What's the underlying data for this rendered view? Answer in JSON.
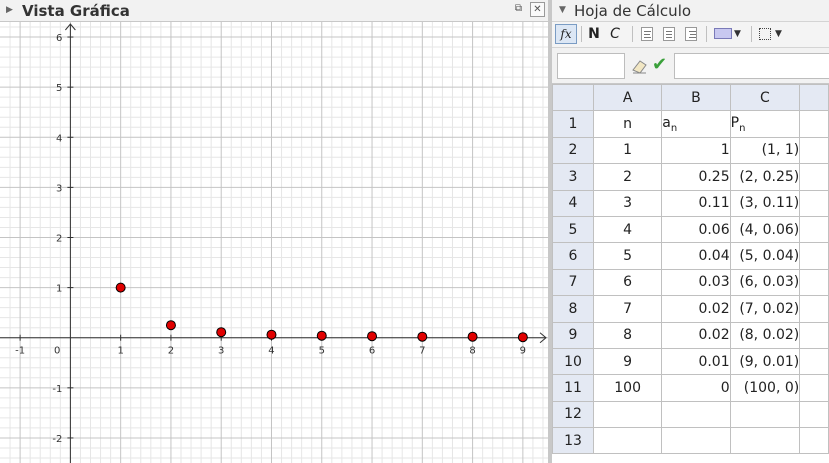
{
  "graphics_view": {
    "title": "Vista Gráfica",
    "icons": [
      "collapse-triangle-icon",
      "undock-icon",
      "close-icon"
    ]
  },
  "spreadsheet_view": {
    "title": "Hoja de Cálculo",
    "toolbar": {
      "fx_label": "fx",
      "bold_label": "N",
      "italic_label": "C",
      "icons": [
        "align-left-icon",
        "align-center-icon",
        "align-right-icon",
        "background-color-icon",
        "border-icon"
      ]
    },
    "input_bar": {
      "name_box_value": "",
      "formula_value": ""
    },
    "column_headers": [
      "A",
      "B",
      "C"
    ],
    "rows": [
      {
        "row": "1",
        "a": "n",
        "b": "a",
        "b_sub": "n",
        "c": "P",
        "c_sub": "n"
      },
      {
        "row": "2",
        "a": "1",
        "b": "1",
        "c": "(1, 1)"
      },
      {
        "row": "3",
        "a": "2",
        "b": "0.25",
        "c": "(2, 0.25)"
      },
      {
        "row": "4",
        "a": "3",
        "b": "0.11",
        "c": "(3, 0.11)"
      },
      {
        "row": "5",
        "a": "4",
        "b": "0.06",
        "c": "(4, 0.06)"
      },
      {
        "row": "6",
        "a": "5",
        "b": "0.04",
        "c": "(5, 0.04)"
      },
      {
        "row": "7",
        "a": "6",
        "b": "0.03",
        "c": "(6, 0.03)"
      },
      {
        "row": "8",
        "a": "7",
        "b": "0.02",
        "c": "(7, 0.02)"
      },
      {
        "row": "9",
        "a": "8",
        "b": "0.02",
        "c": "(8, 0.02)"
      },
      {
        "row": "10",
        "a": "9",
        "b": "0.01",
        "c": "(9, 0.01)"
      },
      {
        "row": "11",
        "a": "100",
        "b": "0",
        "c": "(100, 0)"
      },
      {
        "row": "12",
        "a": "",
        "b": "",
        "c": ""
      },
      {
        "row": "13",
        "a": "",
        "b": "",
        "c": ""
      }
    ]
  },
  "chart_data": {
    "type": "scatter",
    "xlim": [
      -1.4,
      9.5
    ],
    "ylim": [
      -2.5,
      6.3
    ],
    "x_ticks": [
      "-1",
      "1",
      "2",
      "3",
      "4",
      "5",
      "6",
      "7",
      "8",
      "9"
    ],
    "y_ticks": [
      "-2",
      "-1",
      "1",
      "2",
      "3",
      "4",
      "5",
      "6"
    ],
    "origin_label": "0",
    "grid": true,
    "minor_grid_step": 0.2,
    "point_color": "#e00000",
    "points": [
      {
        "x": 1,
        "y": 1
      },
      {
        "x": 2,
        "y": 0.25
      },
      {
        "x": 3,
        "y": 0.11
      },
      {
        "x": 4,
        "y": 0.06
      },
      {
        "x": 5,
        "y": 0.04
      },
      {
        "x": 6,
        "y": 0.03
      },
      {
        "x": 7,
        "y": 0.02
      },
      {
        "x": 8,
        "y": 0.02
      },
      {
        "x": 9,
        "y": 0.01
      }
    ]
  }
}
